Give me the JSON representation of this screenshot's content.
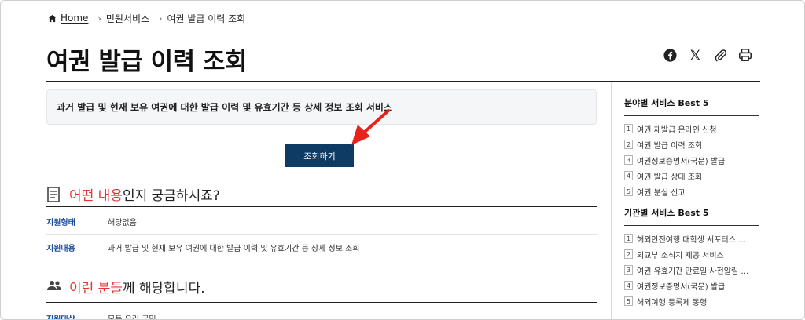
{
  "breadcrumb": {
    "home": "Home",
    "section": "민원서비스",
    "current": "여권 발급 이력 조회"
  },
  "page": {
    "title": "여권 발급 이력 조회",
    "summary": "과거 발급 및 현재 보유 여권에 대한 발급 이력 및 유효기간 등 상세 정보 조회 서비스",
    "lookup_button": "조회하기"
  },
  "share": {
    "icons": [
      "facebook-icon",
      "x-icon",
      "attach-icon",
      "print-icon"
    ]
  },
  "section_content": {
    "accent": "어떤 내용",
    "rest": "인지 궁금하시죠?",
    "rows": [
      {
        "label": "지원형태",
        "value": "해당없음"
      },
      {
        "label": "지원내용",
        "value": "과거 발급 및 현재 보유 여권에 대한 발급 이력 및 유효기간 등 상세 정보 조회"
      }
    ]
  },
  "section_target": {
    "accent": "이런 분들",
    "rest": "께 해당합니다.",
    "rows": [
      {
        "label": "지원대상",
        "value": "모든 우리 국민"
      }
    ]
  },
  "sidebar": {
    "field_title": "분야별 서비스 Best 5",
    "field_items": [
      {
        "num": "1",
        "label": "여권 재발급 온라인 신청"
      },
      {
        "num": "2",
        "label": "여권 발급 이력 조회"
      },
      {
        "num": "3",
        "label": "여권정보증명서(국문) 발급"
      },
      {
        "num": "4",
        "label": "여권 발급 상태 조회"
      },
      {
        "num": "5",
        "label": "여권 분실 신고"
      }
    ],
    "org_title": "기관별 서비스 Best 5",
    "org_items": [
      {
        "num": "1",
        "label": "해외안전여행 대학생 서포터스 …"
      },
      {
        "num": "2",
        "label": "외교부 소식지 제공 서비스"
      },
      {
        "num": "3",
        "label": "여권 유효기간 만료일 사전알림 …"
      },
      {
        "num": "4",
        "label": "여권정보증명서(국문) 발급"
      },
      {
        "num": "5",
        "label": "해외여행 등록제 동행"
      }
    ]
  },
  "colors": {
    "accent": "#e3342f",
    "button": "#0e3b64",
    "label": "#1f4e9c"
  }
}
